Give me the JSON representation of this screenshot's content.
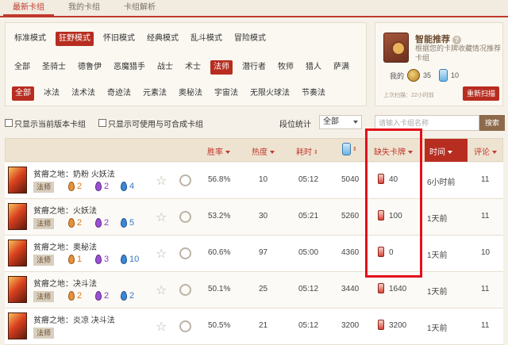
{
  "tabs": [
    "最新卡组",
    "我的卡组",
    "卡组解析"
  ],
  "modes": [
    "标准模式",
    "狂野模式",
    "怀旧模式",
    "经典模式",
    "乱斗模式",
    "冒险模式"
  ],
  "classes": [
    "全部",
    "圣骑士",
    "德鲁伊",
    "恶魔猎手",
    "战士",
    "术士",
    "法师",
    "潜行者",
    "牧师",
    "猎人",
    "萨满"
  ],
  "archetypes": [
    "全部",
    "冰法",
    "法术法",
    "奇迹法",
    "元素法",
    "奥秘法",
    "宇宙法",
    "无限火球法",
    "节奏法"
  ],
  "recommend": {
    "title": "智能推荐",
    "help": "?",
    "desc": "根据您的卡牌收藏情况推荐卡组",
    "mine_label": "我的",
    "gold": "35",
    "dust": "10",
    "last_scan": "上次扫描：22小时前",
    "rescan": "重新扫描"
  },
  "filters": {
    "only_current": "只显示当前版本卡组",
    "only_craftable": "只显示可使用与可合成卡组",
    "segment_label": "段位统计",
    "segment_value": "全部",
    "search_placeholder": "请输入卡组名称",
    "search_button": "搜索"
  },
  "headers": {
    "winrate": "胜率",
    "popularity": "热度",
    "duration": "耗时",
    "missing": "缺失卡牌",
    "time": "时间",
    "comments": "评论"
  },
  "decks": [
    {
      "name": "贫瘠之地：奶粉 火妖法",
      "cls": "法师",
      "orange": "2",
      "purple": "2",
      "blue": "4",
      "winrate": "56.8%",
      "heat": "10",
      "duration": "05:12",
      "dust": "5040",
      "missing": "40",
      "time": "6小时前",
      "comments": "11"
    },
    {
      "name": "贫瘠之地：火妖法",
      "cls": "法师",
      "orange": "2",
      "purple": "2",
      "blue": "5",
      "winrate": "53.2%",
      "heat": "30",
      "duration": "05:21",
      "dust": "5260",
      "missing": "100",
      "time": "1天前",
      "comments": "11"
    },
    {
      "name": "贫瘠之地：奥秘法",
      "cls": "法师",
      "orange": "1",
      "purple": "3",
      "blue": "10",
      "winrate": "60.6%",
      "heat": "97",
      "duration": "05:00",
      "dust": "4360",
      "missing": "0",
      "time": "1天前",
      "comments": "10"
    },
    {
      "name": "贫瘠之地：决斗法",
      "cls": "法师",
      "orange": "2",
      "purple": "2",
      "blue": "2",
      "winrate": "50.1%",
      "heat": "25",
      "duration": "05:12",
      "dust": "3440",
      "missing": "1640",
      "time": "1天前",
      "comments": "11"
    },
    {
      "name": "贫瘠之地：炎凉 决斗法",
      "cls": "法师",
      "orange": "",
      "purple": "",
      "blue": "",
      "winrate": "50.5%",
      "heat": "21",
      "duration": "05:12",
      "dust": "3200",
      "missing": "3200",
      "time": "1天前",
      "comments": "11"
    }
  ]
}
